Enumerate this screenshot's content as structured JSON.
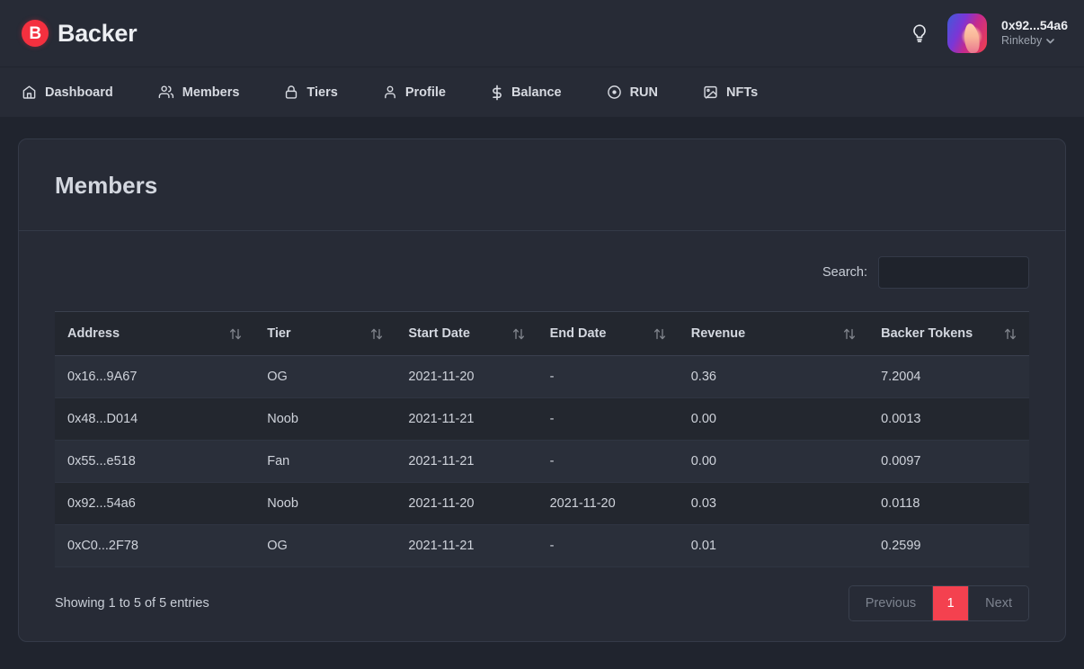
{
  "brand": {
    "mark_letter": "B",
    "name": "Backer",
    "mark_color": "#f4303f"
  },
  "topbar": {
    "bulb_icon": "lightbulb-icon",
    "avatar_icon": "user-avatar",
    "account_address": "0x92...54a6",
    "network": "Rinkeby",
    "network_chevron": "chevron-down-icon"
  },
  "nav": {
    "items": [
      {
        "label": "Dashboard",
        "icon": "home-icon"
      },
      {
        "label": "Members",
        "icon": "users-icon"
      },
      {
        "label": "Tiers",
        "icon": "lock-icon"
      },
      {
        "label": "Profile",
        "icon": "user-icon"
      },
      {
        "label": "Balance",
        "icon": "dollar-icon"
      },
      {
        "label": "RUN",
        "icon": "target-icon"
      },
      {
        "label": "NFTs",
        "icon": "image-icon"
      }
    ]
  },
  "card": {
    "title": "Members"
  },
  "search": {
    "label": "Search:",
    "value": "",
    "placeholder": ""
  },
  "table": {
    "columns": [
      {
        "label": "Address",
        "sort_icon": "sort-updown-icon"
      },
      {
        "label": "Tier",
        "sort_icon": "sort-updown-icon"
      },
      {
        "label": "Start Date",
        "sort_icon": "sort-updown-icon"
      },
      {
        "label": "End Date",
        "sort_icon": "sort-updown-icon"
      },
      {
        "label": "Revenue",
        "sort_icon": "sort-updown-icon"
      },
      {
        "label": "Backer Tokens",
        "sort_icon": "sort-updown-icon"
      }
    ],
    "rows": [
      {
        "address": "0x16...9A67",
        "tier": "OG",
        "start_date": "2021-11-20",
        "end_date": "-",
        "revenue": "0.36",
        "backer_tokens": "7.2004"
      },
      {
        "address": "0x48...D014",
        "tier": "Noob",
        "start_date": "2021-11-21",
        "end_date": "-",
        "revenue": "0.00",
        "backer_tokens": "0.0013"
      },
      {
        "address": "0x55...e518",
        "tier": "Fan",
        "start_date": "2021-11-21",
        "end_date": "-",
        "revenue": "0.00",
        "backer_tokens": "0.0097"
      },
      {
        "address": "0x92...54a6",
        "tier": "Noob",
        "start_date": "2021-11-20",
        "end_date": "2021-11-20",
        "revenue": "0.03",
        "backer_tokens": "0.0118"
      },
      {
        "address": "0xC0...2F78",
        "tier": "OG",
        "start_date": "2021-11-21",
        "end_date": "-",
        "revenue": "0.01",
        "backer_tokens": "0.2599"
      }
    ]
  },
  "footer": {
    "entries_info": "Showing 1 to 5 of 5 entries",
    "previous_label": "Previous",
    "current_page": "1",
    "next_label": "Next",
    "active_page_color": "#f4414f"
  }
}
